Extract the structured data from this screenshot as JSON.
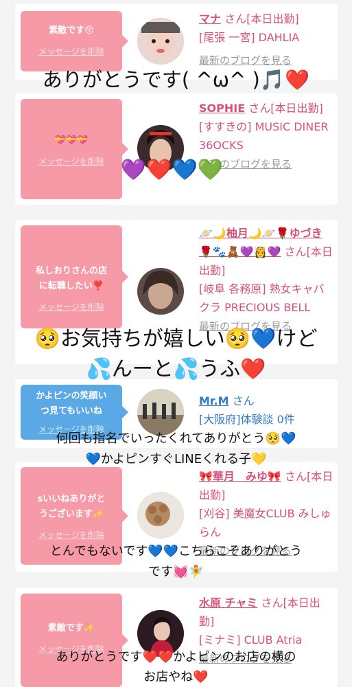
{
  "cards": [
    {
      "message": "素敵です😚",
      "delete_label": "メッセージを削除",
      "name": "マナ",
      "san": "さん[本日出勤]",
      "shop": "[尾張 一宮] DAHLIA",
      "blog": "最新のブログを見る"
    },
    {
      "message": "💝💝💝",
      "delete_label": "メッセージを削除",
      "name": "SOPHIE",
      "san": "さん[本日出勤]",
      "shop": "[すすきの] MUSIC DINER 36OCKS",
      "blog": "最新のブログを見る"
    },
    {
      "message": "私しおりさんの店\nに転職したい❣️",
      "delete_label": "メッセージを削除",
      "name": "🪐🌙柚月🌙🪐🌹ゆづき🌹🐾🧸💜👸💜",
      "san": "さん[本日出勤]",
      "shop": "[岐阜 各務原] 熟女キャバクラ PRECIOUS BELL",
      "blog": "最新のブログを見る"
    },
    {
      "message": "かよピンの笑顔い\nつ見てもいいね",
      "delete_label": "メッセージを削除",
      "name": "Mr.M",
      "san": "さん",
      "shop": "[大阪府]体験談 0件",
      "blog": ""
    },
    {
      "message": "sいいねありがと\nうございます✨",
      "delete_label": "メッセージを削除",
      "name": "🎀華月　みゆ🎀",
      "san": "さん[本日出勤]",
      "shop": "[刈谷] 美魔女CLUB みしゅらん",
      "blog": "最新のブログを見る"
    },
    {
      "message": "素敵です✨",
      "delete_label": "メッセージを削除",
      "name": "水原 チャミ",
      "san": "さん[本日出勤]",
      "shop": "[ミナミ] CLUB Atria",
      "blog": "最新のブログを見る"
    }
  ],
  "overlays": {
    "o1": "ありがとうです( ^ω^ )🎵❤️",
    "o2": "💜❤️💙💚",
    "o3": "🥺お気持ちが嬉しい🥺💙けど\n💦んーと💦うふ❤️",
    "o4": "何回も指名でいったくれてありがとう🥺💙\n💙かよピンすぐLINEくれる子💛",
    "o5": "とんでもないです💙💙こちらこそありがとう\nです💓🧚",
    "o6": "ありがとうです❤️❤️かよピンのお店の横の\nお店やね❤️"
  },
  "colors": {
    "bubble_pink": "#f79aa8",
    "bubble_blue": "#5aa9e6",
    "name_pink": "#d9507a",
    "name_blue": "#2f7cc8"
  }
}
